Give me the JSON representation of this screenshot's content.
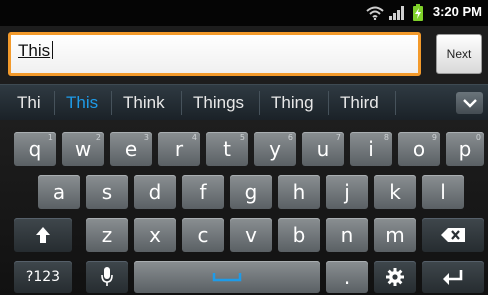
{
  "status_bar": {
    "time": "3:20 PM",
    "icons": [
      "wifi-icon",
      "signal-icon",
      "battery-charging-icon"
    ],
    "battery_color": "#7fd12a"
  },
  "input": {
    "value": "This",
    "next_label": "Next",
    "border_color": "#f39a2b"
  },
  "suggestions": {
    "items": [
      "Thi",
      "This",
      "Think",
      "Things",
      "Thing",
      "Third"
    ],
    "active_index": 1,
    "active_color": "#1e9be8",
    "expand_icon": "chevron-down-icon"
  },
  "keyboard": {
    "row1": [
      {
        "label": "q",
        "hint": "1"
      },
      {
        "label": "w",
        "hint": "2"
      },
      {
        "label": "e",
        "hint": "3"
      },
      {
        "label": "r",
        "hint": "4"
      },
      {
        "label": "t",
        "hint": "5"
      },
      {
        "label": "y",
        "hint": "6"
      },
      {
        "label": "u",
        "hint": "7"
      },
      {
        "label": "i",
        "hint": "8"
      },
      {
        "label": "o",
        "hint": "9"
      },
      {
        "label": "p",
        "hint": "0"
      }
    ],
    "row2": [
      "a",
      "s",
      "d",
      "f",
      "g",
      "h",
      "j",
      "k",
      "l"
    ],
    "row3": [
      "z",
      "x",
      "c",
      "v",
      "b",
      "n",
      "m"
    ],
    "symbols_label": "?123",
    "period_label": ".",
    "icons": {
      "shift": "shift-arrow-icon",
      "backspace": "backspace-icon",
      "mic": "microphone-icon",
      "space": "space-bar-icon",
      "settings": "gear-icon",
      "enter": "enter-return-icon"
    },
    "space_accent": "#1e9be8"
  }
}
